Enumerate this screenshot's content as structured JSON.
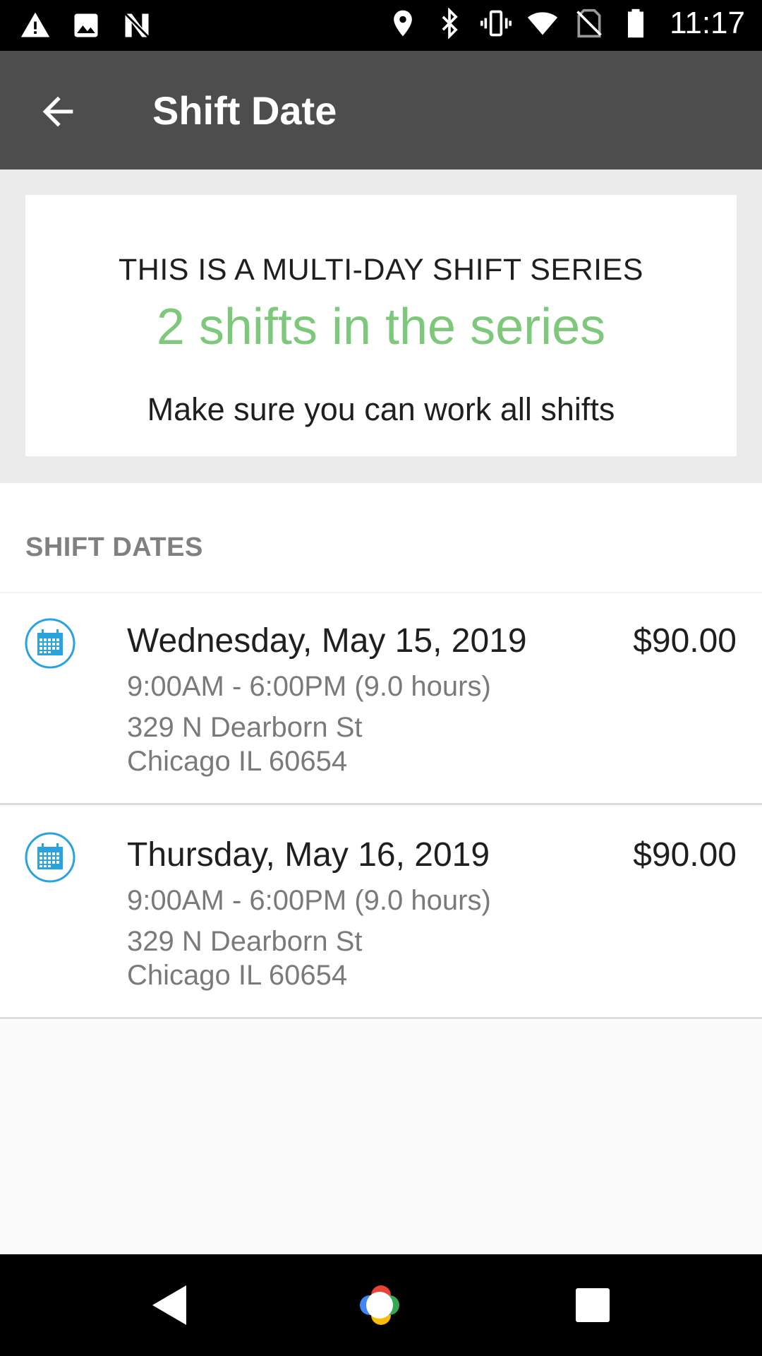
{
  "status_bar": {
    "time": "11:17",
    "left_icons": [
      "warning-icon",
      "image-icon",
      "n-app-icon"
    ],
    "right_icons": [
      "location-icon",
      "bluetooth-icon",
      "vibrate-icon",
      "wifi-icon",
      "no-sim-icon",
      "battery-icon"
    ]
  },
  "toolbar": {
    "title": "Shift Date",
    "back_icon": "arrow-back-icon",
    "background": "#4d4d4d"
  },
  "banner": {
    "heading": "THIS IS A MULTI-DAY SHIFT SERIES",
    "count_text": "2 shifts in the series",
    "note": "Make sure you can work all shifts",
    "accent_color": "#7dc87b"
  },
  "shift_dates": {
    "header": "SHIFT DATES",
    "items": [
      {
        "icon": "calendar-icon",
        "date": "Wednesday, May 15, 2019",
        "price": "$90.00",
        "time": "9:00AM - 6:00PM (9.0 hours)",
        "street": "329 N Dearborn St",
        "city": "Chicago IL 60654"
      },
      {
        "icon": "calendar-icon",
        "date": "Thursday, May 16, 2019",
        "price": "$90.00",
        "time": "9:00AM - 6:00PM (9.0 hours)",
        "street": "329 N Dearborn St",
        "city": "Chicago IL 60654"
      }
    ],
    "icon_color": "#29a3e0"
  },
  "nav_bar": {
    "buttons": [
      "back-triangle-icon",
      "home-assistant-icon",
      "recents-square-icon"
    ]
  }
}
